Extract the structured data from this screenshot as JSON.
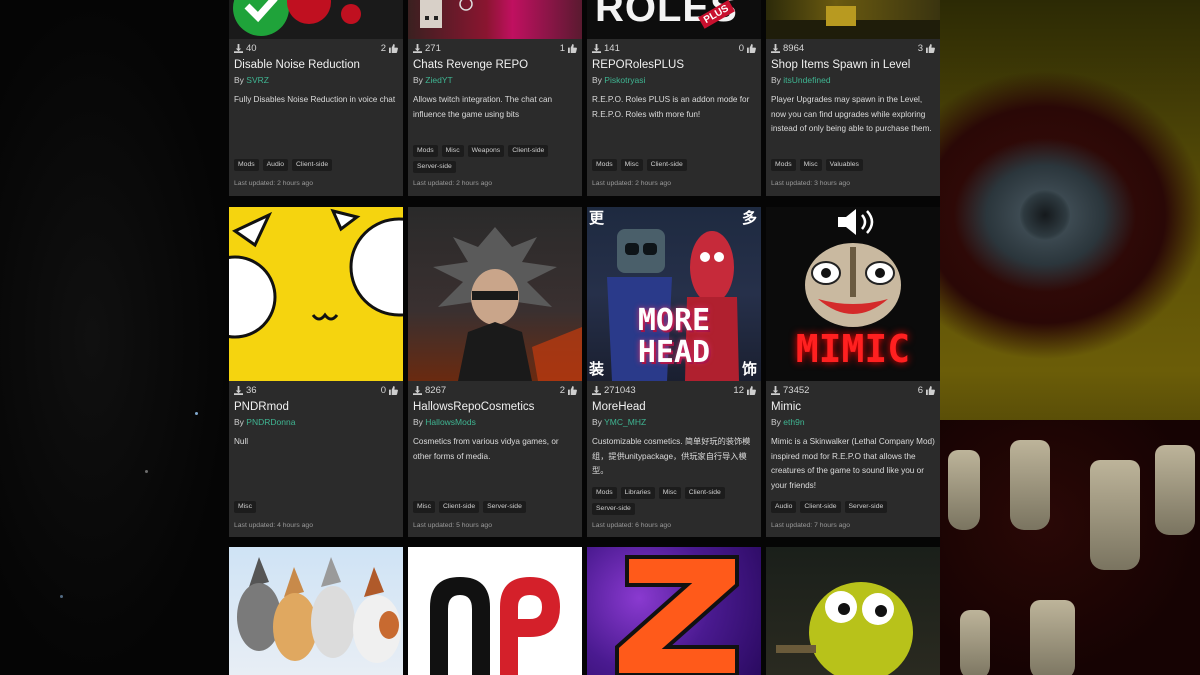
{
  "theme": {
    "card_bg": "#2b2b2b",
    "author_link": "#3fb592",
    "tag_bg": "#1c1c1c"
  },
  "row1": [
    {
      "thumb_text": "",
      "downloads": "40",
      "likes": "2",
      "title": "Disable Noise Reduction",
      "by": "By",
      "author": "SVRZ",
      "description": "Fully Disables Noise Reduction in voice chat",
      "tags": [
        "Mods",
        "Audio",
        "Client-side"
      ],
      "updated": "Last updated: 2 hours ago"
    },
    {
      "thumb_text": "",
      "downloads": "271",
      "likes": "1",
      "title": "Chats Revenge REPO",
      "by": "By",
      "author": "ZiedYT",
      "description": "Allows twitch integration. The chat can influence the game using bits",
      "tags": [
        "Mods",
        "Misc",
        "Weapons",
        "Client-side",
        "Server-side"
      ],
      "updated": "Last updated: 2 hours ago"
    },
    {
      "thumb_text": "ROLES",
      "thumb_badge": "PLUS",
      "downloads": "141",
      "likes": "0",
      "title": "REPORolesPLUS",
      "by": "By",
      "author": "Piskotryasi",
      "description": "R.E.P.O. Roles PLUS is an addon mode for R.E.P.O. Roles with more fun!",
      "tags": [
        "Mods",
        "Misc",
        "Client-side"
      ],
      "updated": "Last updated: 2 hours ago"
    },
    {
      "thumb_text": "",
      "downloads": "8964",
      "likes": "3",
      "title": "Shop Items Spawn in Level",
      "by": "By",
      "author": "itsUndefined",
      "description": "Player Upgrades may spawn in the Level, now you can find upgrades while exploring instead of only being able to purchase them.",
      "tags": [
        "Mods",
        "Misc",
        "Valuables"
      ],
      "updated": "Last updated: 3 hours ago"
    }
  ],
  "row2": [
    {
      "thumb_text": "",
      "downloads": "36",
      "likes": "0",
      "title": "PNDRmod",
      "by": "By",
      "author": "PNDRDonna",
      "description": "Null",
      "tags": [
        "Misc"
      ],
      "updated": "Last updated: 4 hours ago"
    },
    {
      "thumb_text": "",
      "downloads": "8267",
      "likes": "2",
      "title": "HallowsRepoCosmetics",
      "by": "By",
      "author": "HallowsMods",
      "description": "Cosmetics from various vidya games, or other forms of media.",
      "tags": [
        "Misc",
        "Client-side",
        "Server-side"
      ],
      "updated": "Last updated: 5 hours ago"
    },
    {
      "thumb_text_1": "MORE",
      "thumb_text_2": "HEAD",
      "thumb_cn_tl": "更",
      "thumb_cn_tr": "多",
      "thumb_cn_bl": "装",
      "thumb_cn_br": "饰",
      "downloads": "271043",
      "likes": "12",
      "title": "MoreHead",
      "by": "By",
      "author": "YMC_MHZ",
      "description": "Customizable cosmetics. 简单好玩的装饰模组，提供unitypackage，供玩家自行导入模型。",
      "tags": [
        "Mods",
        "Libraries",
        "Misc",
        "Client-side",
        "Server-side"
      ],
      "updated": "Last updated: 6 hours ago"
    },
    {
      "thumb_text": "MIMIC",
      "downloads": "73452",
      "likes": "6",
      "title": "Mimic",
      "by": "By",
      "author": "eth9n",
      "description": "Mimic is a Skinwalker (Lethal Company Mod) inspired mod for R.E.P.O that allows the creatures of the game to sound like you or your friends!",
      "tags": [
        "Audio",
        "Client-side",
        "Server-side"
      ],
      "updated": "Last updated: 7 hours ago"
    }
  ]
}
